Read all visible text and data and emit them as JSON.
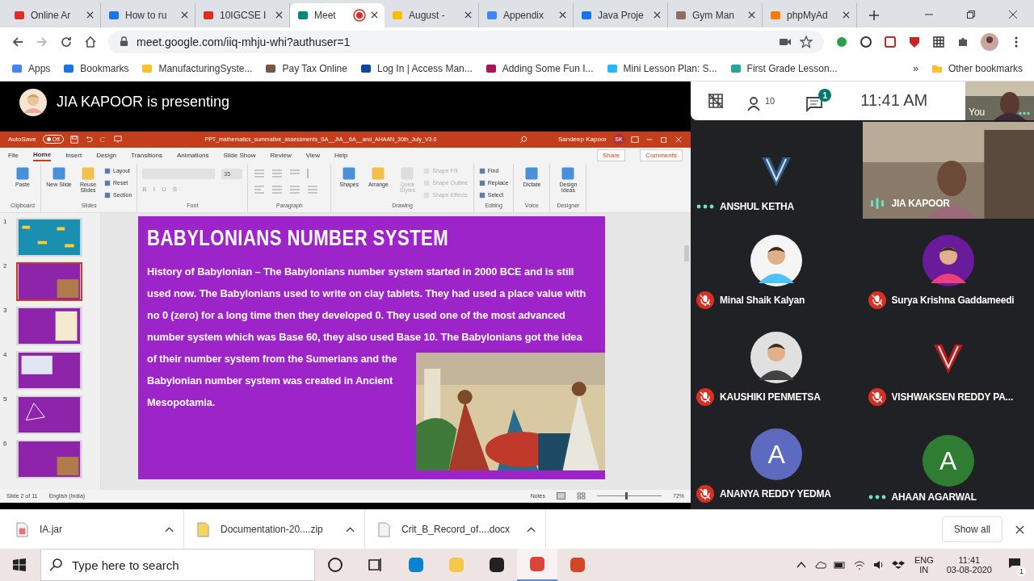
{
  "browser": {
    "tabs": [
      {
        "title": "Online Ar",
        "kind": "gmail",
        "selected": false
      },
      {
        "title": "How to ru",
        "kind": "forms",
        "selected": false
      },
      {
        "title": "10IGCSE I",
        "kind": "gmail",
        "selected": false
      },
      {
        "title": "Meet",
        "kind": "meet",
        "selected": true,
        "recording": true
      },
      {
        "title": "August -",
        "kind": "drive",
        "selected": false
      },
      {
        "title": "Appendix",
        "kind": "docs",
        "selected": false
      },
      {
        "title": "Java Proje",
        "kind": "forms",
        "selected": false
      },
      {
        "title": "Gym Man",
        "selected": false
      },
      {
        "title": "phpMyAd",
        "kind": "pma",
        "selected": false
      }
    ],
    "address": "meet.google.com/iiq-mhju-whi?authuser=1",
    "bookmarks": [
      "Apps",
      "Bookmarks",
      "ManufacturingSyste...",
      "Pay Tax Online",
      "Log In | Access Man...",
      "Adding Some Fun I...",
      "Mini Lesson Plan: S...",
      "First Grade Lesson..."
    ],
    "more": "»",
    "other_bookmarks": "Other bookmarks"
  },
  "meet": {
    "presenting": "JIA KAPOOR is presenting",
    "people_count": "10",
    "chat_badge": "1",
    "time": "11:41 AM",
    "self_label": "You"
  },
  "powerpoint": {
    "autosave": "AutoSave",
    "autosave_state": "Off",
    "title": "PPT_mathematics_summative_assessments_SA__JIA__6A__and_AHAAN_30th_July_V3.0",
    "user": "Sandeep Kapoor",
    "user_initials": "SK",
    "menu": [
      {
        "label": "File",
        "selected": false
      },
      {
        "label": "Home",
        "selected": true
      },
      {
        "label": "Insert",
        "selected": false
      },
      {
        "label": "Design",
        "selected": false
      },
      {
        "label": "Transitions",
        "selected": false
      },
      {
        "label": "Animations",
        "selected": false
      },
      {
        "label": "Slide Show",
        "selected": false
      },
      {
        "label": "Review",
        "selected": false
      },
      {
        "label": "View",
        "selected": false
      },
      {
        "label": "Help",
        "selected": false
      }
    ],
    "share": "Share",
    "comments": "Comments",
    "groups": [
      {
        "name": "Clipboard",
        "items": [
          {
            "label": "Paste",
            "kind": "large",
            "disabled": false
          }
        ]
      },
      {
        "name": "Slides",
        "items": [
          {
            "label": "New Slide",
            "kind": "large",
            "disabled": false
          },
          {
            "label": "Reuse Slides",
            "kind": "large",
            "disabled": false
          },
          {
            "label": "Layout",
            "kind": "small",
            "disabled": false
          },
          {
            "label": "Reset",
            "kind": "small",
            "disabled": false
          },
          {
            "label": "Section",
            "kind": "small",
            "disabled": false
          }
        ]
      },
      {
        "name": "Font",
        "kind": "font",
        "font_size": "35",
        "format_buttons": [
          "B",
          "I",
          "U",
          "S"
        ]
      },
      {
        "name": "Paragraph",
        "kind": "paragraph"
      },
      {
        "name": "Drawing",
        "items": [
          {
            "label": "Shapes",
            "kind": "large",
            "disabled": false
          },
          {
            "label": "Arrange",
            "kind": "large",
            "disabled": false
          },
          {
            "label": "Quick Styles",
            "kind": "large",
            "disabled": true
          },
          {
            "label": "Shape Fill",
            "kind": "small",
            "disabled": true
          },
          {
            "label": "Shape Outline",
            "kind": "small",
            "disabled": true
          },
          {
            "label": "Shape Effects",
            "kind": "small",
            "disabled": true
          }
        ]
      },
      {
        "name": "Editing",
        "items": [
          {
            "label": "Find",
            "kind": "small",
            "disabled": false
          },
          {
            "label": "Replace",
            "kind": "small",
            "disabled": false
          },
          {
            "label": "Select",
            "kind": "small",
            "disabled": false
          }
        ]
      },
      {
        "name": "Voice",
        "items": [
          {
            "label": "Dictate",
            "kind": "large",
            "disabled": false
          }
        ]
      },
      {
        "name": "Designer",
        "items": [
          {
            "label": "Design Ideas",
            "kind": "large",
            "disabled": false
          }
        ]
      }
    ],
    "thumbnails": [
      {
        "number": "1",
        "selected": false,
        "kind": "pattern"
      },
      {
        "number": "2",
        "selected": true,
        "kind": "picture"
      },
      {
        "number": "3",
        "selected": false,
        "kind": "table"
      },
      {
        "number": "4",
        "selected": false,
        "kind": "grid"
      },
      {
        "number": "5",
        "selected": false,
        "kind": "shape"
      },
      {
        "number": "6",
        "selected": false,
        "kind": "picture"
      }
    ],
    "slide": {
      "title": "BABYLONIANS NUMBER SYSTEM",
      "lines_full": [
        "History of Babylonian – The Babylonians number system started in 2000 BCE and is still",
        "used now. The Babylonians used to write on clay tablets. They had used a place value with",
        "no 0 (zero) for a long time then they developed 0. They used one of the most advanced",
        "number system which was Base 60, they also used Base 10. The Babylonians got the idea"
      ],
      "lines_beside_picture": [
        "of their number system from the Sumerians and the",
        "Babylonian number system was created in Ancient",
        "Mesopotamia."
      ]
    },
    "status": {
      "slide": "Slide 2 of 11",
      "language": "English (India)",
      "notes": "Notes",
      "zoom": "72%",
      "zoom_slider": {
        "level": 0.45
      }
    }
  },
  "participants": [
    {
      "name": "ANSHUL KETHA",
      "kind": "logo",
      "muted": false,
      "speaking": false
    },
    {
      "name": "JIA KAPOOR",
      "kind": "video",
      "muted": false,
      "speaking": true
    },
    {
      "name": "Minal Shaik Kalyan",
      "muted": true,
      "speaking": false
    },
    {
      "name": "Surya Krishna Gaddameedi",
      "muted": true,
      "speaking": false
    },
    {
      "name": "KAUSHIKI PENMETSA",
      "muted": true,
      "speaking": false
    },
    {
      "name": "VISHWAKSEN REDDY PA...",
      "kind": "logo",
      "muted": true,
      "speaking": false
    },
    {
      "name": "ANANYA REDDY YEDMA",
      "kind": "letter",
      "letter": "A",
      "color": "#5c6bc0",
      "muted": true,
      "speaking": false
    },
    {
      "name": "AHAAN AGARWAL",
      "kind": "letter",
      "letter": "A",
      "color": "#2e7d32",
      "muted": false,
      "speaking": false
    }
  ],
  "downloads": [
    {
      "name": "IA.jar",
      "kind": "jar"
    },
    {
      "name": "Documentation-20....zip",
      "kind": "zip"
    },
    {
      "name": "Crit_B_Record_of....docx",
      "kind": "doc"
    }
  ],
  "show_all": "Show all",
  "taskbar": {
    "search_placeholder": "Type here to search",
    "language": "ENG",
    "region": "IN",
    "time": "11:41",
    "date": "03-08-2020",
    "notifications": "1"
  }
}
